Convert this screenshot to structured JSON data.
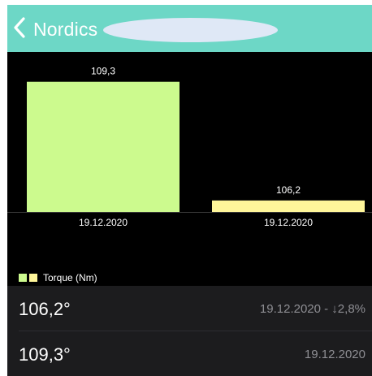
{
  "header": {
    "back_label": "Nordics",
    "background": "#6dd7c6"
  },
  "chart_data": {
    "type": "bar",
    "categories": [
      "19.12.2020",
      "19.12.2020"
    ],
    "series": [
      {
        "name": "Torque (Nm)",
        "values": [
          109.3,
          106.2
        ]
      }
    ],
    "value_labels": [
      "109,3",
      "106,2"
    ],
    "bar_colors": [
      "#ccfa8e",
      "#fff69a"
    ],
    "legend": {
      "label": "Torque (Nm)",
      "position": "bottom-left",
      "swatch_colors": [
        "#ccfa8e",
        "#fff69a"
      ]
    },
    "ylim": [
      105.9,
      109.4
    ],
    "grid": false,
    "title": "",
    "xlabel": "",
    "ylabel": ""
  },
  "list": {
    "items": [
      {
        "value": "106,2°",
        "meta": "19.12.2020 - ↓2,8%"
      },
      {
        "value": "109,3°",
        "meta": "19.12.2020"
      }
    ]
  }
}
